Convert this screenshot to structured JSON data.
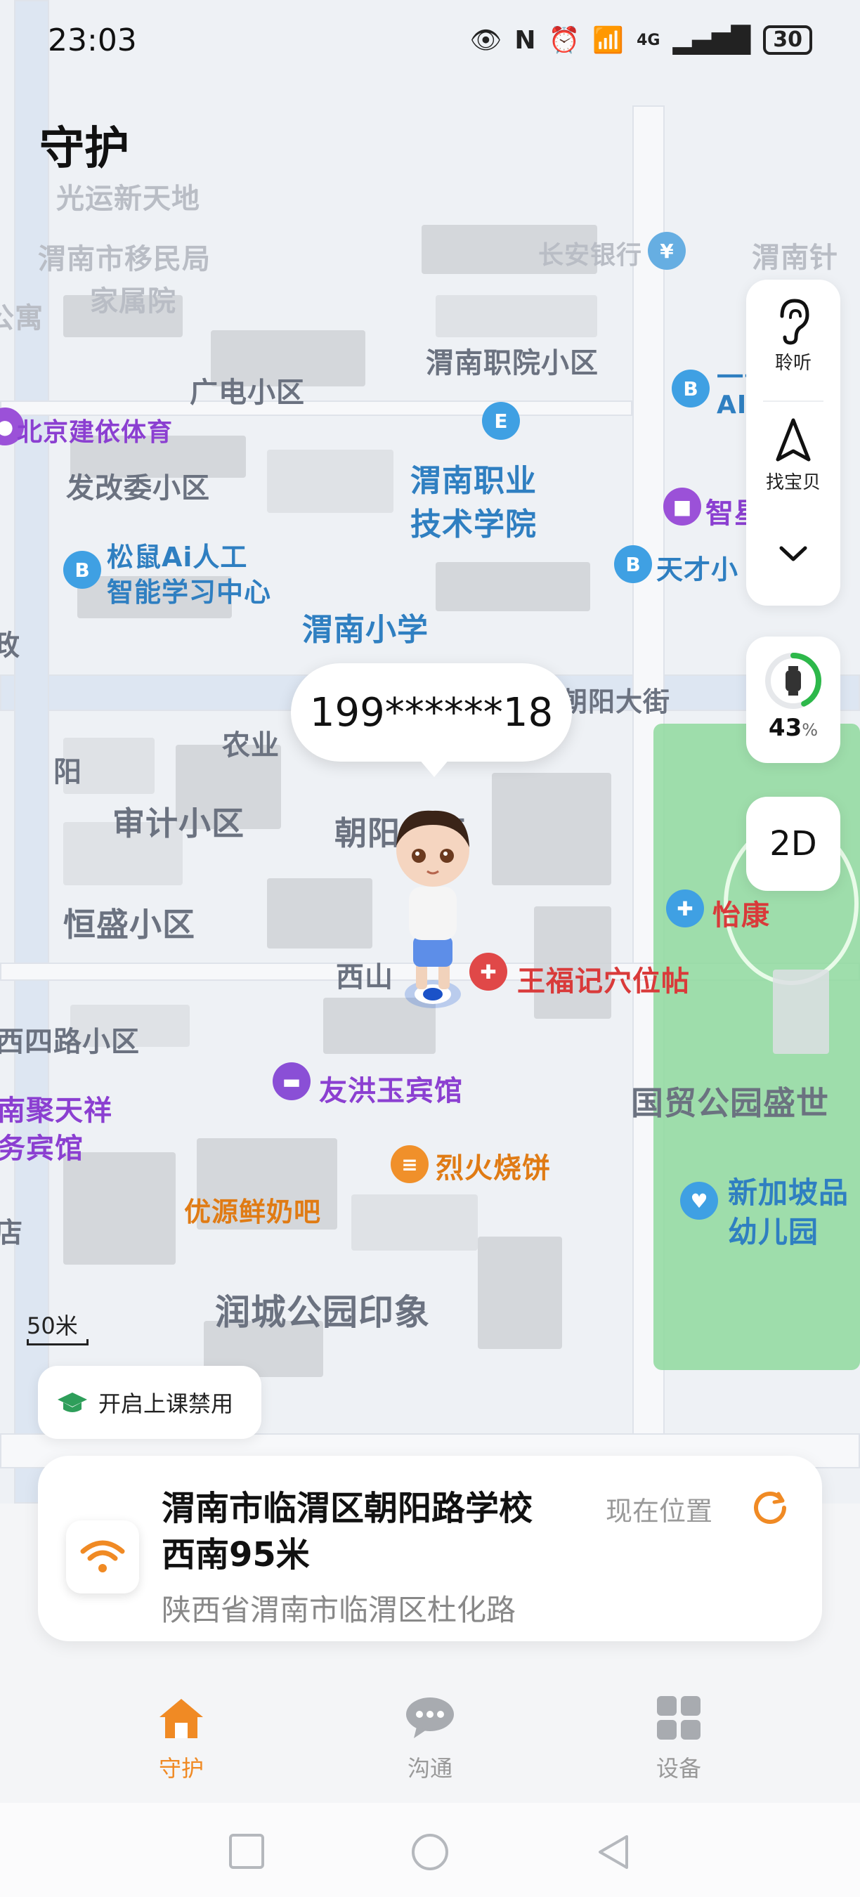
{
  "status_bar": {
    "time": "23:03",
    "network": "4G",
    "battery": "30"
  },
  "page_title": "守护",
  "map": {
    "labels": {
      "guangyun": "光运新天地",
      "immigration": "渭南市移民局",
      "jiashuyuan": "家属院",
      "gongyu": "公寓",
      "changan_bank": "长安银行",
      "weinan_zhen": "渭南针",
      "vocational_district": "渭南职院小区",
      "guangdian": "广电小区",
      "beijing_jianyi": "北京建依体育",
      "fagaiwei": "发改委小区",
      "vocational_1": "渭南职业",
      "vocational_2": "技术学院",
      "zhixing": "智星",
      "songshu_1": "松鼠Ai人工",
      "songshu_2": "智能学习中心",
      "tiancai": "天才小",
      "primary_school": "渭南小学",
      "zheng": "政",
      "chaoyang_street": "朝阳大街",
      "nongye": "农业",
      "yang": "阳",
      "shenji": "审计小区",
      "chaoyang_district": "朝阳小区",
      "hengsheng": "恒盛小区",
      "yikang": "怡康",
      "xishan": "西山",
      "wangfuji": "王福记穴位帖",
      "xisilu": "西四路小区",
      "youhong": "友洪玉宾馆",
      "guomao": "国贸公园盛世",
      "nanjutianxiang": "南聚天祥",
      "wubinguan": "务宾馆",
      "liehuo": "烈火烧饼",
      "singapore_1": "新加坡品",
      "singapore_2": "幼儿园",
      "youyuan": "优源鲜奶吧",
      "dian": "店",
      "runcheng": "润城公园印象",
      "yiyuan": "一号",
      "ai": "AI"
    },
    "scale": "50米"
  },
  "controls": {
    "listen_label": "聆听",
    "find_label": "找宝贝",
    "battery_percent": "43",
    "percent_sign": "%",
    "mode": "2D"
  },
  "bubble": {
    "phone": "199******18"
  },
  "class_ban": {
    "label": "开启上课禁用"
  },
  "location": {
    "title": "渭南市临渭区朝阳路学校西南95米",
    "status": "现在位置",
    "address": "陕西省渭南市临渭区杜化路"
  },
  "bottom_nav": {
    "items": [
      {
        "label": "守护",
        "active": true
      },
      {
        "label": "沟通",
        "active": false
      },
      {
        "label": "设备",
        "active": false
      }
    ]
  },
  "colors": {
    "accent": "#f08a24",
    "battery_green": "#2db84a"
  }
}
